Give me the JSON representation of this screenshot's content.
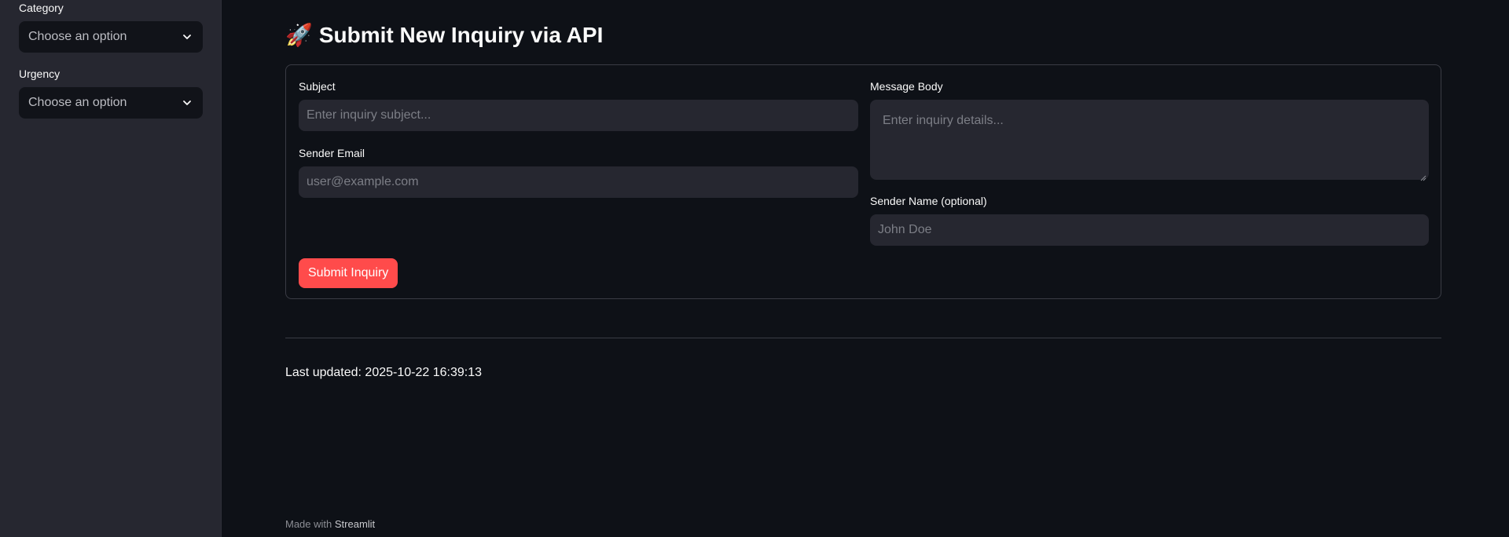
{
  "sidebar": {
    "category": {
      "label": "Category",
      "value": "Choose an option"
    },
    "urgency": {
      "label": "Urgency",
      "value": "Choose an option"
    }
  },
  "main": {
    "title_icon": "🚀",
    "title": "Submit New Inquiry via API",
    "form": {
      "subject": {
        "label": "Subject",
        "placeholder": "Enter inquiry subject..."
      },
      "sender_email": {
        "label": "Sender Email",
        "placeholder": "user@example.com"
      },
      "message_body": {
        "label": "Message Body",
        "placeholder": "Enter inquiry details..."
      },
      "sender_name": {
        "label": "Sender Name (optional)",
        "placeholder": "John Doe"
      },
      "submit_label": "Submit Inquiry"
    },
    "last_updated": "Last updated: 2025-10-22 16:39:13"
  },
  "footer": {
    "prefix": "Made with",
    "brand": "Streamlit"
  },
  "colors": {
    "background": "#0e1117",
    "sidebar": "#262730",
    "primary": "#ff4b4b",
    "input": "#262730"
  },
  "icons": {
    "select_chevron": "chevron-down-icon",
    "title_icon": "rocket-icon"
  }
}
